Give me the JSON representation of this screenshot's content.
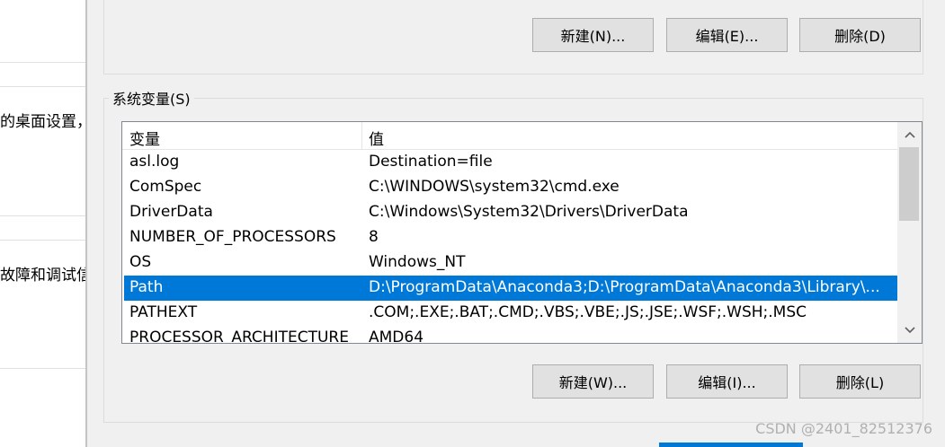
{
  "background_window": {
    "text_1": "的桌面设置，",
    "text_2": "故障和调试信"
  },
  "user_vars": {
    "buttons": {
      "new": "新建(N)...",
      "edit": "编辑(E)...",
      "delete": "删除(D)"
    }
  },
  "system_vars": {
    "group_label": "系统变量(S)",
    "columns": {
      "name": "变量",
      "value": "值"
    },
    "rows": [
      {
        "name": "asl.log",
        "value": "Destination=file"
      },
      {
        "name": "ComSpec",
        "value": "C:\\WINDOWS\\system32\\cmd.exe"
      },
      {
        "name": "DriverData",
        "value": "C:\\Windows\\System32\\Drivers\\DriverData"
      },
      {
        "name": "NUMBER_OF_PROCESSORS",
        "value": "8"
      },
      {
        "name": "OS",
        "value": "Windows_NT"
      },
      {
        "name": "Path",
        "value": "D:\\ProgramData\\Anaconda3;D:\\ProgramData\\Anaconda3\\Library\\..."
      },
      {
        "name": "PATHEXT",
        "value": ".COM;.EXE;.BAT;.CMD;.VBS;.VBE;.JS;.JSE;.WSF;.WSH;.MSC"
      },
      {
        "name": "PROCESSOR_ARCHITECTURE",
        "value": "AMD64"
      }
    ],
    "selected_row": "Path",
    "buttons": {
      "new": "新建(W)...",
      "edit": "编辑(I)...",
      "delete": "删除(L)"
    }
  },
  "watermark": "CSDN @2401_82512376",
  "colors": {
    "selection": "#0078d7",
    "button_face": "#e1e1e1",
    "dialog_bg": "#f0f0f0"
  },
  "icons": {
    "scroll_up": "chevron-up-icon",
    "scroll_down": "chevron-down-icon"
  }
}
